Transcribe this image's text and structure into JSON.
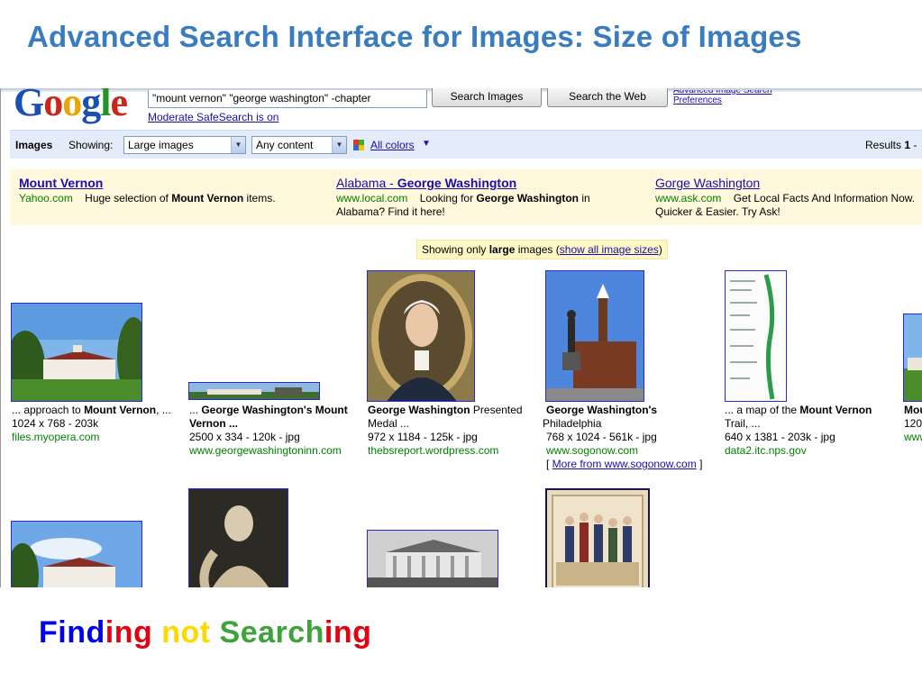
{
  "slide": {
    "title": "Advanced Search Interface for Images: Size of Images"
  },
  "header": {
    "query": "\"mount vernon\" \"george washington\" -chapter",
    "search_images_label": "Search Images",
    "search_web_label": "Search the Web",
    "advanced_search_label": "Advanced Image Search",
    "preferences_label": "Preferences",
    "safesearch_label": "Moderate SafeSearch is on"
  },
  "filter_bar": {
    "images_label": "Images",
    "showing_label": "Showing:",
    "size_value": "Large images",
    "content_value": "Any content",
    "colors_label": "All colors",
    "results_prefix": "Results ",
    "results_number": "1",
    "results_suffix": " -"
  },
  "ads": [
    {
      "title": "Mount Vernon",
      "url": "Yahoo.com",
      "desc_pre": "Huge selection of ",
      "desc_bold": "Mount Vernon",
      "desc_post": " items."
    },
    {
      "title_pre": "Alabama - ",
      "title_bold": "George Washington",
      "url": "www.local.com",
      "desc_pre": "Looking for ",
      "desc_bold": "George Washington",
      "desc_post": " in Alabama? Find it here!"
    },
    {
      "title": "Gorge Washington",
      "url": "www.ask.com",
      "desc": "Get Local Facts And Information Now. Quicker & Easier. Try Ask!"
    }
  ],
  "notice": {
    "pre": "Showing only ",
    "bold": "large",
    "mid": " images (",
    "link": "show all image sizes",
    "post": ")"
  },
  "results": [
    {
      "title_pre": "... approach to ",
      "title_bold": "Mount Vernon",
      "title_post": ", ...",
      "meta": "1024 x 768 - 203k",
      "url": "files.myopera.com"
    },
    {
      "title_pre": "... ",
      "title_bold": "George Washington's Mount Vernon ...",
      "title_post": "",
      "meta": "2500 x 334 - 120k - jpg",
      "url": "www.georgewashingtoninn.com"
    },
    {
      "title_pre": "",
      "title_bold": "George Washington",
      "title_post": " Presented Medal ...",
      "meta": "972 x 1184 - 125k - jpg",
      "url": "thebsreport.wordpress.com"
    },
    {
      "title_pre": "",
      "title_bold": "George Washington's",
      "title_post": " Philadelphia",
      "meta": "768 x 1024 - 561k - jpg",
      "url": "www.sogonow.com",
      "more": "More from www.sogonow.com"
    },
    {
      "title_pre": "... a map of the ",
      "title_bold": "Mount Vernon",
      "title_post": " Trail, ...",
      "meta": "640 x 1381 - 203k - jpg",
      "url": "data2.itc.nps.gov"
    },
    {
      "title_pre": "",
      "title_bold": "Mou",
      "title_post": "",
      "meta": "120",
      "url": "www"
    }
  ],
  "tagline": {
    "p1": "Find",
    "p2": "ing",
    "p3": "not",
    "p4": "Search",
    "p5": "ing"
  },
  "colors": {
    "title": "#3a7cc0",
    "link": "#1a0dab",
    "url_green": "#008000",
    "bar_bg": "#e5ecf9",
    "ad_bg": "#fff8dd"
  }
}
